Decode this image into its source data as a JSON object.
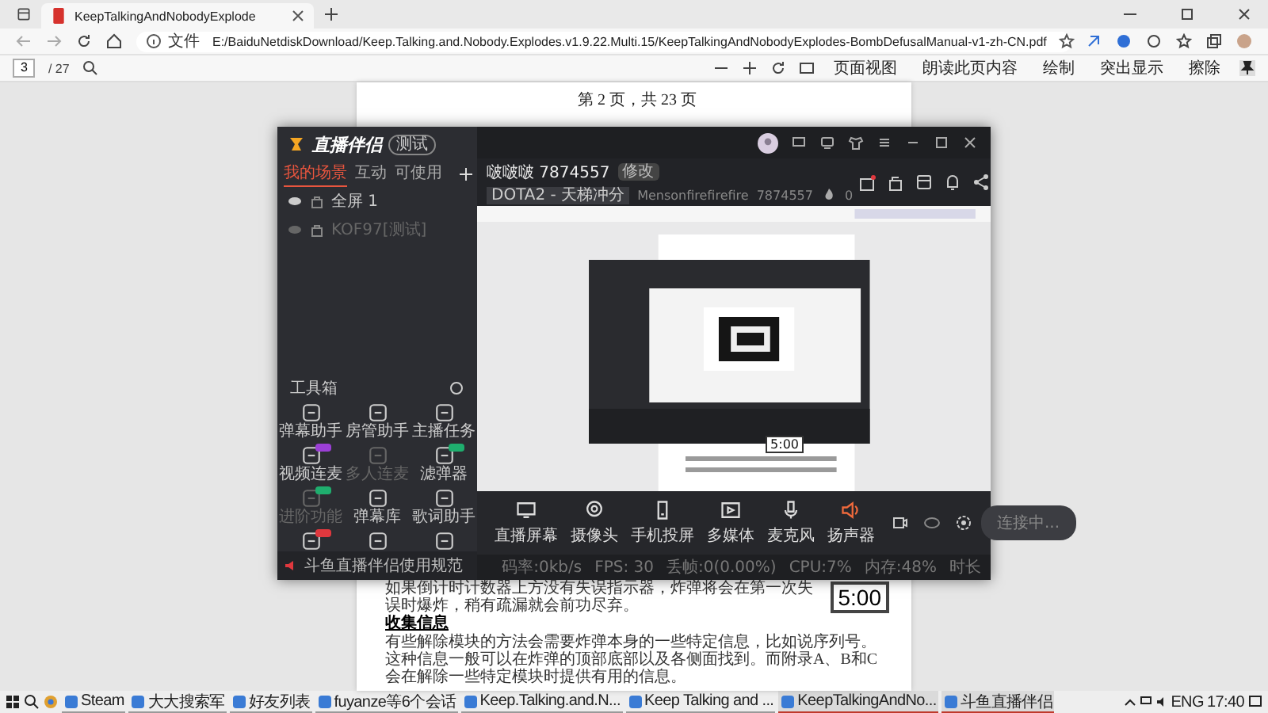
{
  "browser": {
    "tabs": [
      {
        "title": "KeepTalkingAndNobodyExplode",
        "selected": true
      }
    ],
    "address": {
      "scheme": "文件",
      "url": "E:/BaiduNetdiskDownload/Keep.Talking.and.Nobody.Explodes.v1.9.22.Multi.15/KeepTalkingAndNobodyExplodes-BombDefusalManual-v1-zh-CN.pdf"
    }
  },
  "pdf_toolbar": {
    "page": "3",
    "page_count": "/ 27",
    "tools": [
      {
        "label": "页面视图"
      },
      {
        "label": "朗读此页内容"
      },
      {
        "label": "绘制"
      },
      {
        "label": "突出显示"
      },
      {
        "label": "擦除"
      }
    ]
  },
  "pdf_page": {
    "header": "第 2 页，共 23 页",
    "paragraph_1": "如果倒计时计数器上方没有失误指示器，炸弹将会在第一次失误时爆炸，稍有疏漏就会前功尽弃。",
    "timer": "5:00",
    "heading": "收集信息",
    "paragraph_2": "有些解除模块的方法会需要炸弹本身的一些特定信息，比如说序列号。这种信息一般可以在炸弹的顶部底部以及各侧面找到。而附录A、B和C会在解除一些特定模块时提供有用的信息。"
  },
  "app": {
    "logo": "直播伴侣",
    "badge": "测试",
    "tabs": [
      {
        "label": "我的场景",
        "selected": true
      },
      {
        "label": "互动",
        "selected": false
      },
      {
        "label": "可使用",
        "selected": false
      }
    ],
    "scenes": [
      {
        "label": "全屏 1",
        "visible": true
      },
      {
        "label": "KOF97[测试]",
        "visible": false
      }
    ],
    "toolbox_title": "工具箱",
    "tools": [
      {
        "label": "弹幕助手",
        "disabled": false
      },
      {
        "label": "房管助手",
        "disabled": false
      },
      {
        "label": "主播任务",
        "disabled": false
      },
      {
        "label": "视频连麦",
        "disabled": false,
        "color": "#9b3fd6"
      },
      {
        "label": "多人连麦",
        "disabled": true
      },
      {
        "label": "滤弹器",
        "disabled": false,
        "color": "#1fae6e"
      },
      {
        "label": "进阶功能",
        "disabled": true,
        "color": "#1fae6e"
      },
      {
        "label": "弹幕库",
        "disabled": false
      },
      {
        "label": "歌词助手",
        "disabled": false
      },
      {
        "disabled": false,
        "color": "#e0383e"
      },
      {
        "disabled": false
      },
      {
        "disabled": false
      }
    ],
    "notice": "斗鱼直播伴侣使用规范",
    "room": {
      "name": "啵啵啵 7874557",
      "edit": "修改",
      "category": "DOTA2 - 天梯冲分",
      "streamer": "Mensonfirefirefire",
      "room_id": "7874557",
      "popularity": "0"
    },
    "capture_timer": "5:00",
    "controls": [
      {
        "label": "直播屏幕"
      },
      {
        "label": "摄像头"
      },
      {
        "label": "手机投屏"
      },
      {
        "label": "多媒体"
      },
      {
        "label": "麦克风"
      },
      {
        "label": "扬声器"
      }
    ],
    "live_button": {
      "label": "连接中...",
      "disabled": true
    },
    "status": [
      "码率:0kb/s",
      "FPS: 30",
      "丢帧:0(0.00%)",
      "CPU:7%",
      "内存:48%",
      "时长"
    ]
  },
  "taskbar": {
    "items": [
      {
        "label": "Steam",
        "active": false
      },
      {
        "label": "大大搜索军",
        "active": false
      },
      {
        "label": "好友列表",
        "active": false
      },
      {
        "label": "fuyanze等6个会话",
        "active": false
      },
      {
        "label": "Keep.Talking.and.N...",
        "active": false
      },
      {
        "label": "Keep Talking and ...",
        "active": false
      },
      {
        "label": "KeepTalkingAndNo...",
        "active": true
      },
      {
        "label": "斗鱼直播伴侣",
        "active": true
      }
    ],
    "lang": "ENG",
    "time": "17:40"
  }
}
